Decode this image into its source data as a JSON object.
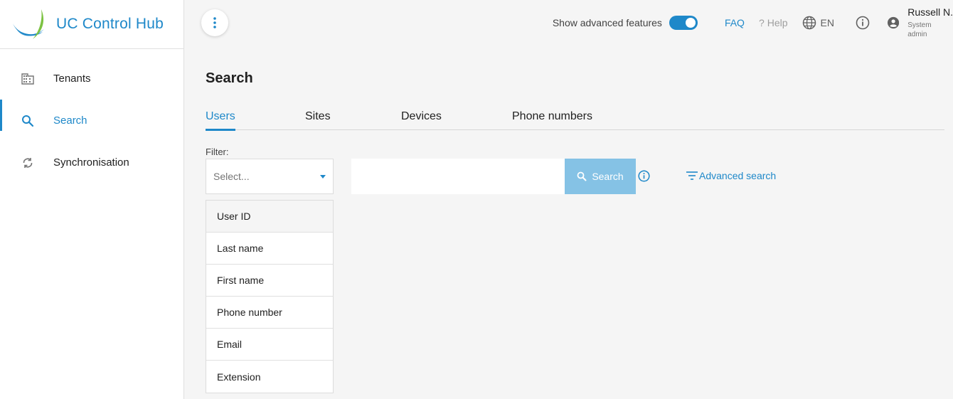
{
  "app": {
    "title": "UC Control Hub",
    "accent_color": "#1e88c9",
    "logo_colors": [
      "#1e88c9",
      "#7cc242"
    ]
  },
  "sidebar": {
    "items": [
      {
        "label": "Tenants",
        "icon": "building-icon",
        "active": false
      },
      {
        "label": "Search",
        "icon": "search-icon",
        "active": true
      },
      {
        "label": "Synchronisation",
        "icon": "sync-icon",
        "active": false
      }
    ]
  },
  "topbar": {
    "advanced_label": "Show advanced features",
    "advanced_enabled": true,
    "faq_label": "FAQ",
    "help_label": "Help",
    "language": "EN",
    "user_name": "Russell N.",
    "user_role": "System admin"
  },
  "page": {
    "title": "Search"
  },
  "tabs": [
    {
      "label": "Users",
      "active": true
    },
    {
      "label": "Sites",
      "active": false
    },
    {
      "label": "Devices",
      "active": false
    },
    {
      "label": "Phone numbers",
      "active": false
    }
  ],
  "filter": {
    "label": "Filter:",
    "placeholder": "Select...",
    "options": [
      "User ID",
      "Last name",
      "First name",
      "Phone number",
      "Email",
      "Extension"
    ]
  },
  "search": {
    "input_value": "",
    "button_label": "Search",
    "advanced_label": "Advanced search",
    "button_color": "#85c2e5"
  }
}
